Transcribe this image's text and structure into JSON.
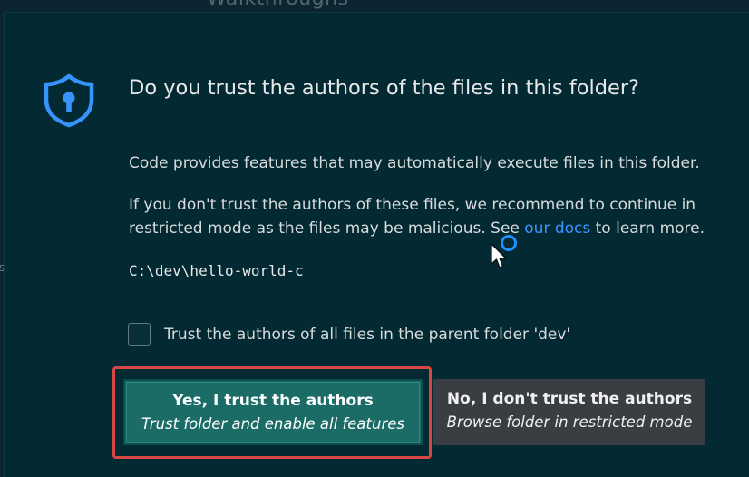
{
  "background": {
    "title": "Walkthroughs",
    "edge_letter": "s"
  },
  "dialog": {
    "title": "Do you trust the authors of the files in this folder?",
    "paragraph1": "Code provides features that may automatically execute files in this folder.",
    "paragraph2_prefix": "If you don't trust the authors of these files, we recommend to continue in restricted mode as the files may be malicious. See ",
    "paragraph2_link": "our docs",
    "paragraph2_suffix": " to learn more.",
    "folder_path": "C:\\dev\\hello-world-c",
    "checkbox": {
      "label": "Trust the authors of all files in the parent folder 'dev'",
      "checked": false
    },
    "buttons": {
      "trust": {
        "title": "Yes, I trust the authors",
        "subtitle": "Trust folder and enable all features"
      },
      "dont_trust": {
        "title": "No, I don't trust the authors",
        "subtitle": "Browse folder in restricted mode"
      }
    }
  },
  "icons": {
    "shield": "shield-lock-icon",
    "cursor": "mouse-pointer-icon",
    "busy": "busy-indicator-icon"
  },
  "colors": {
    "dialog_bg": "#032a33",
    "accent_blue": "#3794ff",
    "primary_button": "#1b6b66",
    "secondary_button": "#3a3d41",
    "highlight_border": "#d94646"
  }
}
